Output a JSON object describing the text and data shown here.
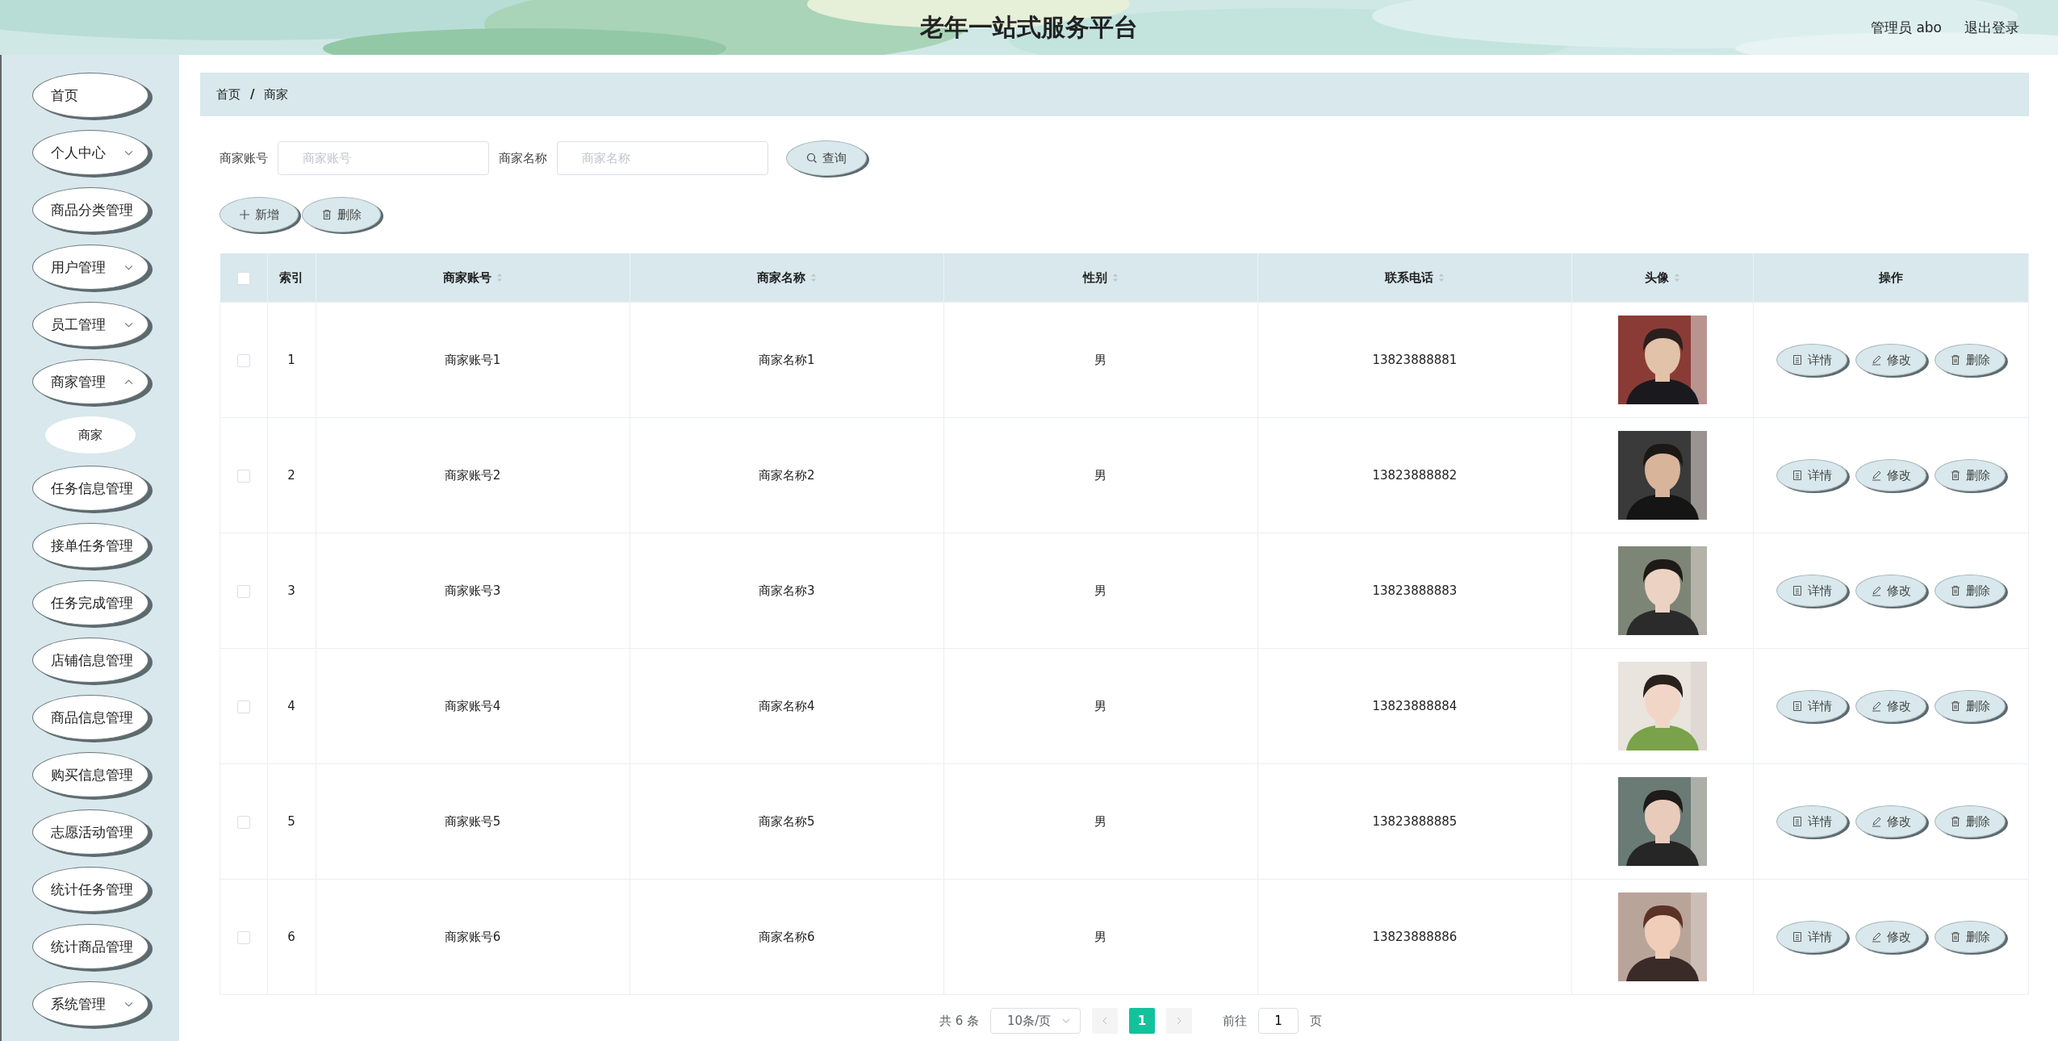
{
  "header": {
    "title": "老年一站式服务平台",
    "user": "管理员 abo",
    "logout": "退出登录"
  },
  "sidebar": {
    "items": [
      {
        "label": "首页",
        "kind": "link"
      },
      {
        "label": "个人中心",
        "kind": "group",
        "expanded": false
      },
      {
        "label": "商品分类管理",
        "kind": "link"
      },
      {
        "label": "用户管理",
        "kind": "group",
        "expanded": false
      },
      {
        "label": "员工管理",
        "kind": "group",
        "expanded": false
      },
      {
        "label": "商家管理",
        "kind": "group",
        "expanded": true,
        "children": [
          {
            "label": "商家"
          }
        ]
      },
      {
        "label": "任务信息管理",
        "kind": "link"
      },
      {
        "label": "接单任务管理",
        "kind": "link"
      },
      {
        "label": "任务完成管理",
        "kind": "link"
      },
      {
        "label": "店铺信息管理",
        "kind": "link"
      },
      {
        "label": "商品信息管理",
        "kind": "link"
      },
      {
        "label": "购买信息管理",
        "kind": "link"
      },
      {
        "label": "志愿活动管理",
        "kind": "link"
      },
      {
        "label": "统计任务管理",
        "kind": "link"
      },
      {
        "label": "统计商品管理",
        "kind": "link"
      },
      {
        "label": "系统管理",
        "kind": "group",
        "expanded": false
      }
    ]
  },
  "breadcrumb": {
    "items": [
      "首页",
      "商家"
    ],
    "separator": "/"
  },
  "search": {
    "fields": [
      {
        "label": "商家账号",
        "placeholder": "商家账号"
      },
      {
        "label": "商家名称",
        "placeholder": "商家名称"
      }
    ],
    "button": "查询"
  },
  "actions": [
    {
      "label": "新增",
      "kind": "add"
    },
    {
      "label": "删除",
      "kind": "delete"
    }
  ],
  "table": {
    "columns": [
      {
        "label": "索引",
        "sortable": false
      },
      {
        "label": "商家账号",
        "sortable": true
      },
      {
        "label": "商家名称",
        "sortable": true
      },
      {
        "label": "性别",
        "sortable": true
      },
      {
        "label": "联系电话",
        "sortable": true
      },
      {
        "label": "头像",
        "sortable": true
      },
      {
        "label": "操作",
        "sortable": false
      }
    ],
    "header_checked": false,
    "rows": [
      {
        "checked": false,
        "index": "1",
        "account": "商家账号1",
        "name": "商家名称1",
        "gender": "男",
        "phone": "13823888881",
        "actions": [
          {
            "label": "详情",
            "kind": "detail"
          },
          {
            "label": "修改",
            "kind": "edit"
          },
          {
            "label": "删除",
            "kind": "delete"
          }
        ]
      },
      {
        "checked": false,
        "index": "2",
        "account": "商家账号2",
        "name": "商家名称2",
        "gender": "男",
        "phone": "13823888882",
        "actions": [
          {
            "label": "详情",
            "kind": "detail"
          },
          {
            "label": "修改",
            "kind": "edit"
          },
          {
            "label": "删除",
            "kind": "delete"
          }
        ]
      },
      {
        "checked": false,
        "index": "3",
        "account": "商家账号3",
        "name": "商家名称3",
        "gender": "男",
        "phone": "13823888883",
        "actions": [
          {
            "label": "详情",
            "kind": "detail"
          },
          {
            "label": "修改",
            "kind": "edit"
          },
          {
            "label": "删除",
            "kind": "delete"
          }
        ]
      },
      {
        "checked": false,
        "index": "4",
        "account": "商家账号4",
        "name": "商家名称4",
        "gender": "男",
        "phone": "13823888884",
        "actions": [
          {
            "label": "详情",
            "kind": "detail"
          },
          {
            "label": "修改",
            "kind": "edit"
          },
          {
            "label": "删除",
            "kind": "delete"
          }
        ]
      },
      {
        "checked": false,
        "index": "5",
        "account": "商家账号5",
        "name": "商家名称5",
        "gender": "男",
        "phone": "13823888885",
        "actions": [
          {
            "label": "详情",
            "kind": "detail"
          },
          {
            "label": "修改",
            "kind": "edit"
          },
          {
            "label": "删除",
            "kind": "delete"
          }
        ]
      },
      {
        "checked": false,
        "index": "6",
        "account": "商家账号6",
        "name": "商家名称6",
        "gender": "男",
        "phone": "13823888886",
        "actions": [
          {
            "label": "详情",
            "kind": "detail"
          },
          {
            "label": "修改",
            "kind": "edit"
          },
          {
            "label": "删除",
            "kind": "delete"
          }
        ]
      }
    ]
  },
  "pagination": {
    "total": "共 6 条",
    "page_size": "10条/页",
    "pages": [
      {
        "label": "1",
        "selected": true
      }
    ],
    "goto_label": "前往",
    "goto_value": "1",
    "goto_suffix": "页"
  }
}
